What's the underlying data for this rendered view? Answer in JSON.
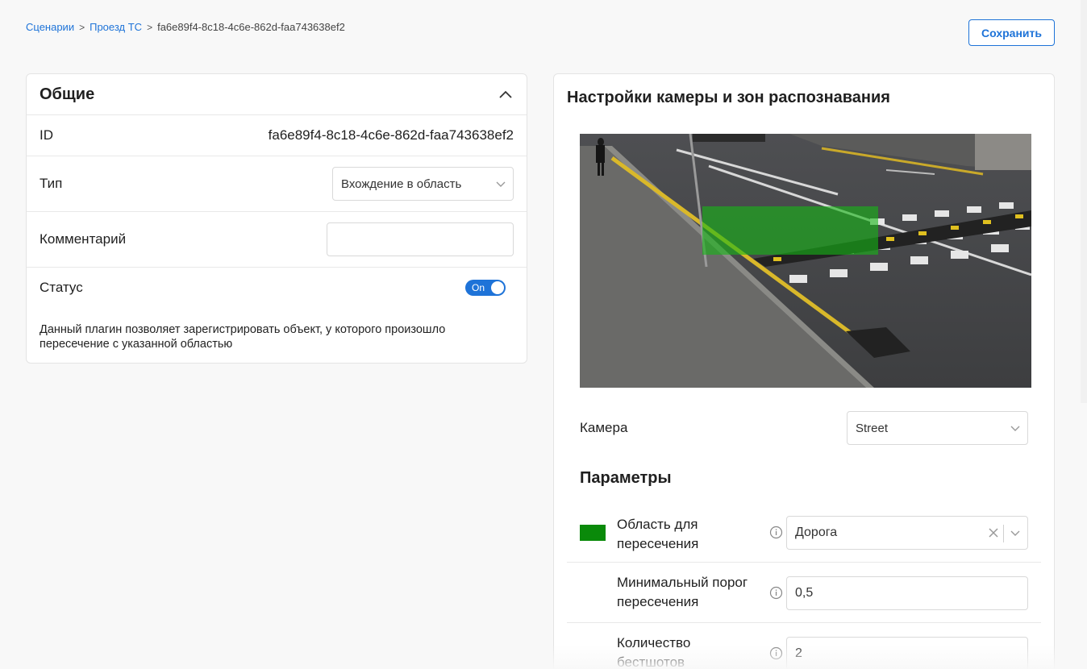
{
  "breadcrumb": {
    "items": [
      "Сценарии",
      "Проезд ТС"
    ],
    "separator": ">",
    "current": "fa6e89f4-8c18-4c6e-862d-faa743638ef2"
  },
  "toolbar": {
    "save_label": "Сохранить"
  },
  "general": {
    "title": "Общие",
    "id_label": "ID",
    "id_value": "fa6e89f4-8c18-4c6e-862d-faa743638ef2",
    "type_label": "Тип",
    "type_value": "Вхождение в область",
    "comment_label": "Комментарий",
    "comment_value": "",
    "status_label": "Статус",
    "status_toggle": "On",
    "description": "Данный плагин позволяет зарегистрировать объект, у которого произошло пересечение с указанной областью"
  },
  "camera_settings": {
    "title": "Настройки камеры и зон распознавания",
    "camera_label": "Камера",
    "camera_value": "Street",
    "zone_color": "#0a8a0a"
  },
  "parameters": {
    "title": "Параметры",
    "items": [
      {
        "label": "Область для пересечения",
        "value": "Дорога"
      },
      {
        "label": "Минимальный порог пересечения",
        "value": "0,5"
      },
      {
        "label": "Количество бестшотов",
        "value": "2"
      }
    ]
  }
}
